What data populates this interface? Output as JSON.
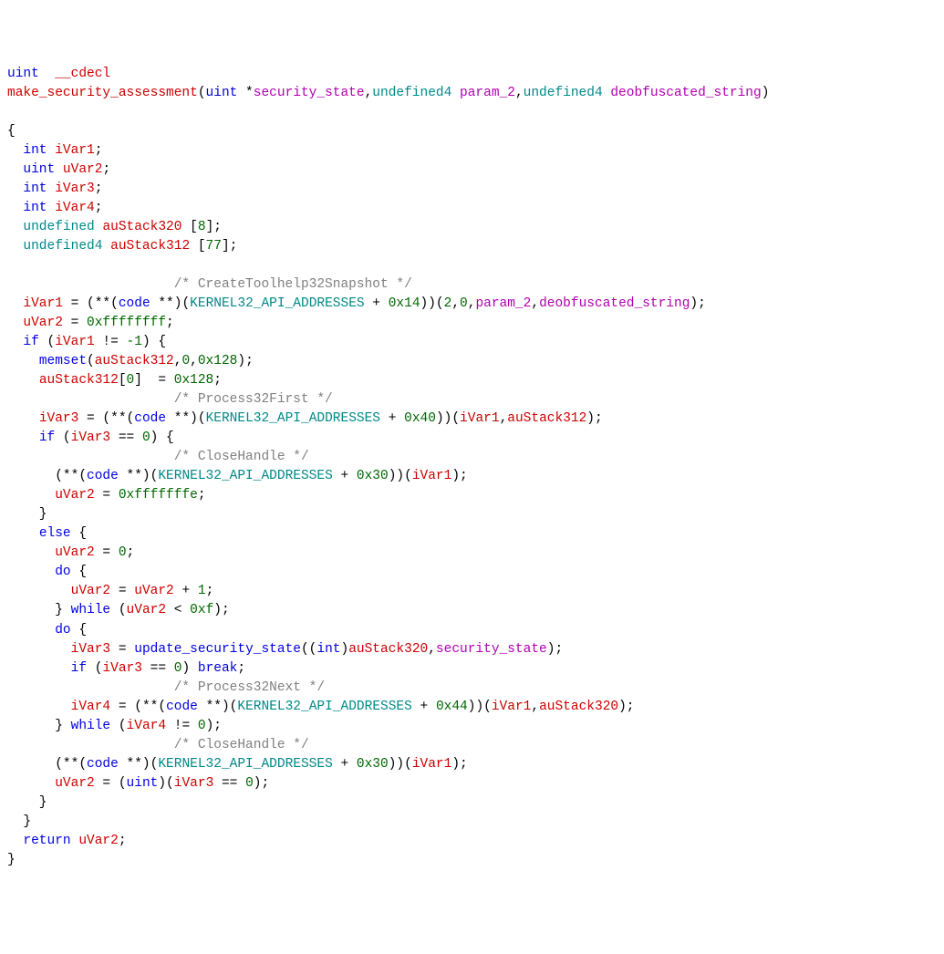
{
  "tokens": [
    [
      [
        "kw",
        "uint"
      ],
      [
        "",
        ""
      ],
      [
        "",
        "  "
      ],
      [
        "ident-red",
        "__cdecl"
      ]
    ],
    [
      [
        "ident-red",
        "make_security_assessment"
      ],
      [
        "",
        "("
      ],
      [
        "kw",
        "uint"
      ],
      [
        "",
        " *"
      ],
      [
        "ident-purple",
        "security_state"
      ],
      [
        "",
        ","
      ],
      [
        "ident-teal",
        "undefined4"
      ],
      [
        "",
        " "
      ],
      [
        "ident-purple",
        "param_2"
      ],
      [
        "",
        ","
      ],
      [
        "ident-teal",
        "undefined4"
      ],
      [
        "",
        " "
      ],
      [
        "ident-purple",
        "deobfuscated_string"
      ],
      [
        "",
        ")"
      ]
    ],
    [
      [
        "",
        ""
      ]
    ],
    [
      [
        "",
        "{"
      ]
    ],
    [
      [
        "",
        "  "
      ],
      [
        "kw",
        "int"
      ],
      [
        "",
        " "
      ],
      [
        "ident-red",
        "iVar1"
      ],
      [
        "",
        ";"
      ]
    ],
    [
      [
        "",
        "  "
      ],
      [
        "kw",
        "uint"
      ],
      [
        "",
        " "
      ],
      [
        "ident-red",
        "uVar2"
      ],
      [
        "",
        ";"
      ]
    ],
    [
      [
        "",
        "  "
      ],
      [
        "kw",
        "int"
      ],
      [
        "",
        " "
      ],
      [
        "ident-red",
        "iVar3"
      ],
      [
        "",
        ";"
      ]
    ],
    [
      [
        "",
        "  "
      ],
      [
        "kw",
        "int"
      ],
      [
        "",
        " "
      ],
      [
        "ident-red",
        "iVar4"
      ],
      [
        "",
        ";"
      ]
    ],
    [
      [
        "",
        "  "
      ],
      [
        "ident-teal",
        "undefined"
      ],
      [
        "",
        " "
      ],
      [
        "ident-red",
        "auStack320"
      ],
      [
        "",
        " ["
      ],
      [
        "num",
        "8"
      ],
      [
        "",
        "];"
      ]
    ],
    [
      [
        "",
        "  "
      ],
      [
        "ident-teal",
        "undefined4"
      ],
      [
        "",
        " "
      ],
      [
        "ident-red",
        "auStack312"
      ],
      [
        "",
        " ["
      ],
      [
        "num",
        "77"
      ],
      [
        "",
        "];"
      ]
    ],
    [
      [
        "",
        "  "
      ]
    ],
    [
      [
        "",
        "                     "
      ],
      [
        "comment",
        "/* CreateToolhelp32Snapshot */"
      ]
    ],
    [
      [
        "",
        "  "
      ],
      [
        "ident-red",
        "iVar1"
      ],
      [
        "",
        " = (**("
      ],
      [
        "kw",
        "code"
      ],
      [
        "",
        " **)("
      ],
      [
        "ident-teal",
        "KERNEL32_API_ADDRESSES"
      ],
      [
        "",
        " + "
      ],
      [
        "num",
        "0x14"
      ],
      [
        "",
        "))("
      ],
      [
        "num",
        "2"
      ],
      [
        "",
        ","
      ],
      [
        "num",
        "0"
      ],
      [
        "",
        ","
      ],
      [
        "ident-purple",
        "param_2"
      ],
      [
        "",
        ","
      ],
      [
        "ident-purple",
        "deobfuscated_string"
      ],
      [
        "",
        ");"
      ]
    ],
    [
      [
        "",
        "  "
      ],
      [
        "ident-red",
        "uVar2"
      ],
      [
        "",
        " = "
      ],
      [
        "num",
        "0xffffffff"
      ],
      [
        "",
        ";"
      ]
    ],
    [
      [
        "",
        "  "
      ],
      [
        "kw",
        "if"
      ],
      [
        "",
        " ("
      ],
      [
        "ident-red",
        "iVar1"
      ],
      [
        "",
        " != "
      ],
      [
        "num",
        "-1"
      ],
      [
        "",
        ") {"
      ]
    ],
    [
      [
        "",
        "    "
      ],
      [
        "func",
        "memset"
      ],
      [
        "",
        "("
      ],
      [
        "ident-red",
        "auStack312"
      ],
      [
        "",
        ","
      ],
      [
        "num",
        "0"
      ],
      [
        "",
        ","
      ],
      [
        "num",
        "0x128"
      ],
      [
        "",
        ");"
      ]
    ],
    [
      [
        "",
        "    "
      ],
      [
        "ident-red",
        "auStack312"
      ],
      [
        "",
        "["
      ],
      [
        "num",
        "0"
      ],
      [
        "",
        "]  = "
      ],
      [
        "num",
        "0x128"
      ],
      [
        "",
        ";"
      ]
    ],
    [
      [
        "",
        "                     "
      ],
      [
        "comment",
        "/* Process32First */"
      ]
    ],
    [
      [
        "",
        "    "
      ],
      [
        "ident-red",
        "iVar3"
      ],
      [
        "",
        " = (**("
      ],
      [
        "kw",
        "code"
      ],
      [
        "",
        " **)("
      ],
      [
        "ident-teal",
        "KERNEL32_API_ADDRESSES"
      ],
      [
        "",
        " + "
      ],
      [
        "num",
        "0x40"
      ],
      [
        "",
        "))("
      ],
      [
        "ident-red",
        "iVar1"
      ],
      [
        "",
        ","
      ],
      [
        "ident-red",
        "auStack312"
      ],
      [
        "",
        ");"
      ]
    ],
    [
      [
        "",
        "    "
      ],
      [
        "kw",
        "if"
      ],
      [
        "",
        " ("
      ],
      [
        "ident-red",
        "iVar3"
      ],
      [
        "",
        " == "
      ],
      [
        "num",
        "0"
      ],
      [
        "",
        ") {"
      ]
    ],
    [
      [
        "",
        "                     "
      ],
      [
        "comment",
        "/* CloseHandle */"
      ]
    ],
    [
      [
        "",
        "      (**("
      ],
      [
        "kw",
        "code"
      ],
      [
        "",
        " **)("
      ],
      [
        "ident-teal",
        "KERNEL32_API_ADDRESSES"
      ],
      [
        "",
        " + "
      ],
      [
        "num",
        "0x30"
      ],
      [
        "",
        "))("
      ],
      [
        "ident-red",
        "iVar1"
      ],
      [
        "",
        ");"
      ]
    ],
    [
      [
        "",
        "      "
      ],
      [
        "ident-red",
        "uVar2"
      ],
      [
        "",
        " = "
      ],
      [
        "num",
        "0xfffffffe"
      ],
      [
        "",
        ";"
      ]
    ],
    [
      [
        "",
        "    }"
      ]
    ],
    [
      [
        "",
        "    "
      ],
      [
        "kw",
        "else"
      ],
      [
        "",
        " {"
      ]
    ],
    [
      [
        "",
        "      "
      ],
      [
        "ident-red",
        "uVar2"
      ],
      [
        "",
        " = "
      ],
      [
        "num",
        "0"
      ],
      [
        "",
        ";"
      ]
    ],
    [
      [
        "",
        "      "
      ],
      [
        "kw",
        "do"
      ],
      [
        "",
        " {"
      ]
    ],
    [
      [
        "",
        "        "
      ],
      [
        "ident-red",
        "uVar2"
      ],
      [
        "",
        " = "
      ],
      [
        "ident-red",
        "uVar2"
      ],
      [
        "",
        " + "
      ],
      [
        "num",
        "1"
      ],
      [
        "",
        ";"
      ]
    ],
    [
      [
        "",
        "      } "
      ],
      [
        "kw",
        "while"
      ],
      [
        "",
        " ("
      ],
      [
        "ident-red",
        "uVar2"
      ],
      [
        "",
        " < "
      ],
      [
        "num",
        "0xf"
      ],
      [
        "",
        ");"
      ]
    ],
    [
      [
        "",
        "      "
      ],
      [
        "kw",
        "do"
      ],
      [
        "",
        " {"
      ]
    ],
    [
      [
        "",
        "        "
      ],
      [
        "ident-red",
        "iVar3"
      ],
      [
        "",
        " = "
      ],
      [
        "func",
        "update_security_state"
      ],
      [
        "",
        "(("
      ],
      [
        "kw",
        "int"
      ],
      [
        "",
        ")"
      ],
      [
        "ident-red",
        "auStack320"
      ],
      [
        "",
        ","
      ],
      [
        "ident-purple",
        "security_state"
      ],
      [
        "",
        ");"
      ]
    ],
    [
      [
        "",
        "        "
      ],
      [
        "kw",
        "if"
      ],
      [
        "",
        " ("
      ],
      [
        "ident-red",
        "iVar3"
      ],
      [
        "",
        " == "
      ],
      [
        "num",
        "0"
      ],
      [
        "",
        ") "
      ],
      [
        "kw",
        "break"
      ],
      [
        "",
        ";"
      ]
    ],
    [
      [
        "",
        "                     "
      ],
      [
        "comment",
        "/* Process32Next */"
      ]
    ],
    [
      [
        "",
        "        "
      ],
      [
        "ident-red",
        "iVar4"
      ],
      [
        "",
        " = (**("
      ],
      [
        "kw",
        "code"
      ],
      [
        "",
        " **)("
      ],
      [
        "ident-teal",
        "KERNEL32_API_ADDRESSES"
      ],
      [
        "",
        " + "
      ],
      [
        "num",
        "0x44"
      ],
      [
        "",
        "))("
      ],
      [
        "ident-red",
        "iVar1"
      ],
      [
        "",
        ","
      ],
      [
        "ident-red",
        "auStack320"
      ],
      [
        "",
        ");"
      ]
    ],
    [
      [
        "",
        "      } "
      ],
      [
        "kw",
        "while"
      ],
      [
        "",
        " ("
      ],
      [
        "ident-red",
        "iVar4"
      ],
      [
        "",
        " != "
      ],
      [
        "num",
        "0"
      ],
      [
        "",
        ");"
      ]
    ],
    [
      [
        "",
        "                     "
      ],
      [
        "comment",
        "/* CloseHandle */"
      ]
    ],
    [
      [
        "",
        "      (**("
      ],
      [
        "kw",
        "code"
      ],
      [
        "",
        " **)("
      ],
      [
        "ident-teal",
        "KERNEL32_API_ADDRESSES"
      ],
      [
        "",
        " + "
      ],
      [
        "num",
        "0x30"
      ],
      [
        "",
        "))("
      ],
      [
        "ident-red",
        "iVar1"
      ],
      [
        "",
        ");"
      ]
    ],
    [
      [
        "",
        "      "
      ],
      [
        "ident-red",
        "uVar2"
      ],
      [
        "",
        " = ("
      ],
      [
        "kw",
        "uint"
      ],
      [
        "",
        ")("
      ],
      [
        "ident-red",
        "iVar3"
      ],
      [
        "",
        " == "
      ],
      [
        "num",
        "0"
      ],
      [
        "",
        ");"
      ]
    ],
    [
      [
        "",
        "    }"
      ]
    ],
    [
      [
        "",
        "  }"
      ]
    ],
    [
      [
        "",
        "  "
      ],
      [
        "kw",
        "return"
      ],
      [
        "",
        " "
      ],
      [
        "ident-red",
        "uVar2"
      ],
      [
        "",
        ";"
      ]
    ],
    [
      [
        "",
        "}"
      ]
    ]
  ]
}
